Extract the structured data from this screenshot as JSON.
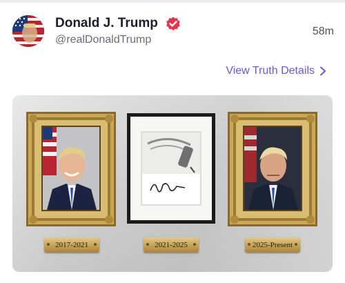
{
  "post": {
    "author": {
      "display_name": "Donald J. Trump",
      "handle": "@realDonaldTrump",
      "verified": true,
      "avatar": "avatar-flag-portrait"
    },
    "timestamp": "58m",
    "details_link": "View Truth Details",
    "details_icon": "chevron-right-icon",
    "media": {
      "frames": [
        {
          "type": "gold-framed-portrait",
          "plaque": "2017-2021"
        },
        {
          "type": "black-framed-autopen-photo",
          "plaque": "2021-2025"
        },
        {
          "type": "gold-framed-portrait",
          "plaque": "2025-Present"
        }
      ]
    }
  },
  "colors": {
    "accent": "#6a58d6",
    "verified_badge": "#e0374f",
    "name_text": "#1d1d2b",
    "secondary_text": "#6b6b78",
    "gold": "#c6a35a"
  }
}
